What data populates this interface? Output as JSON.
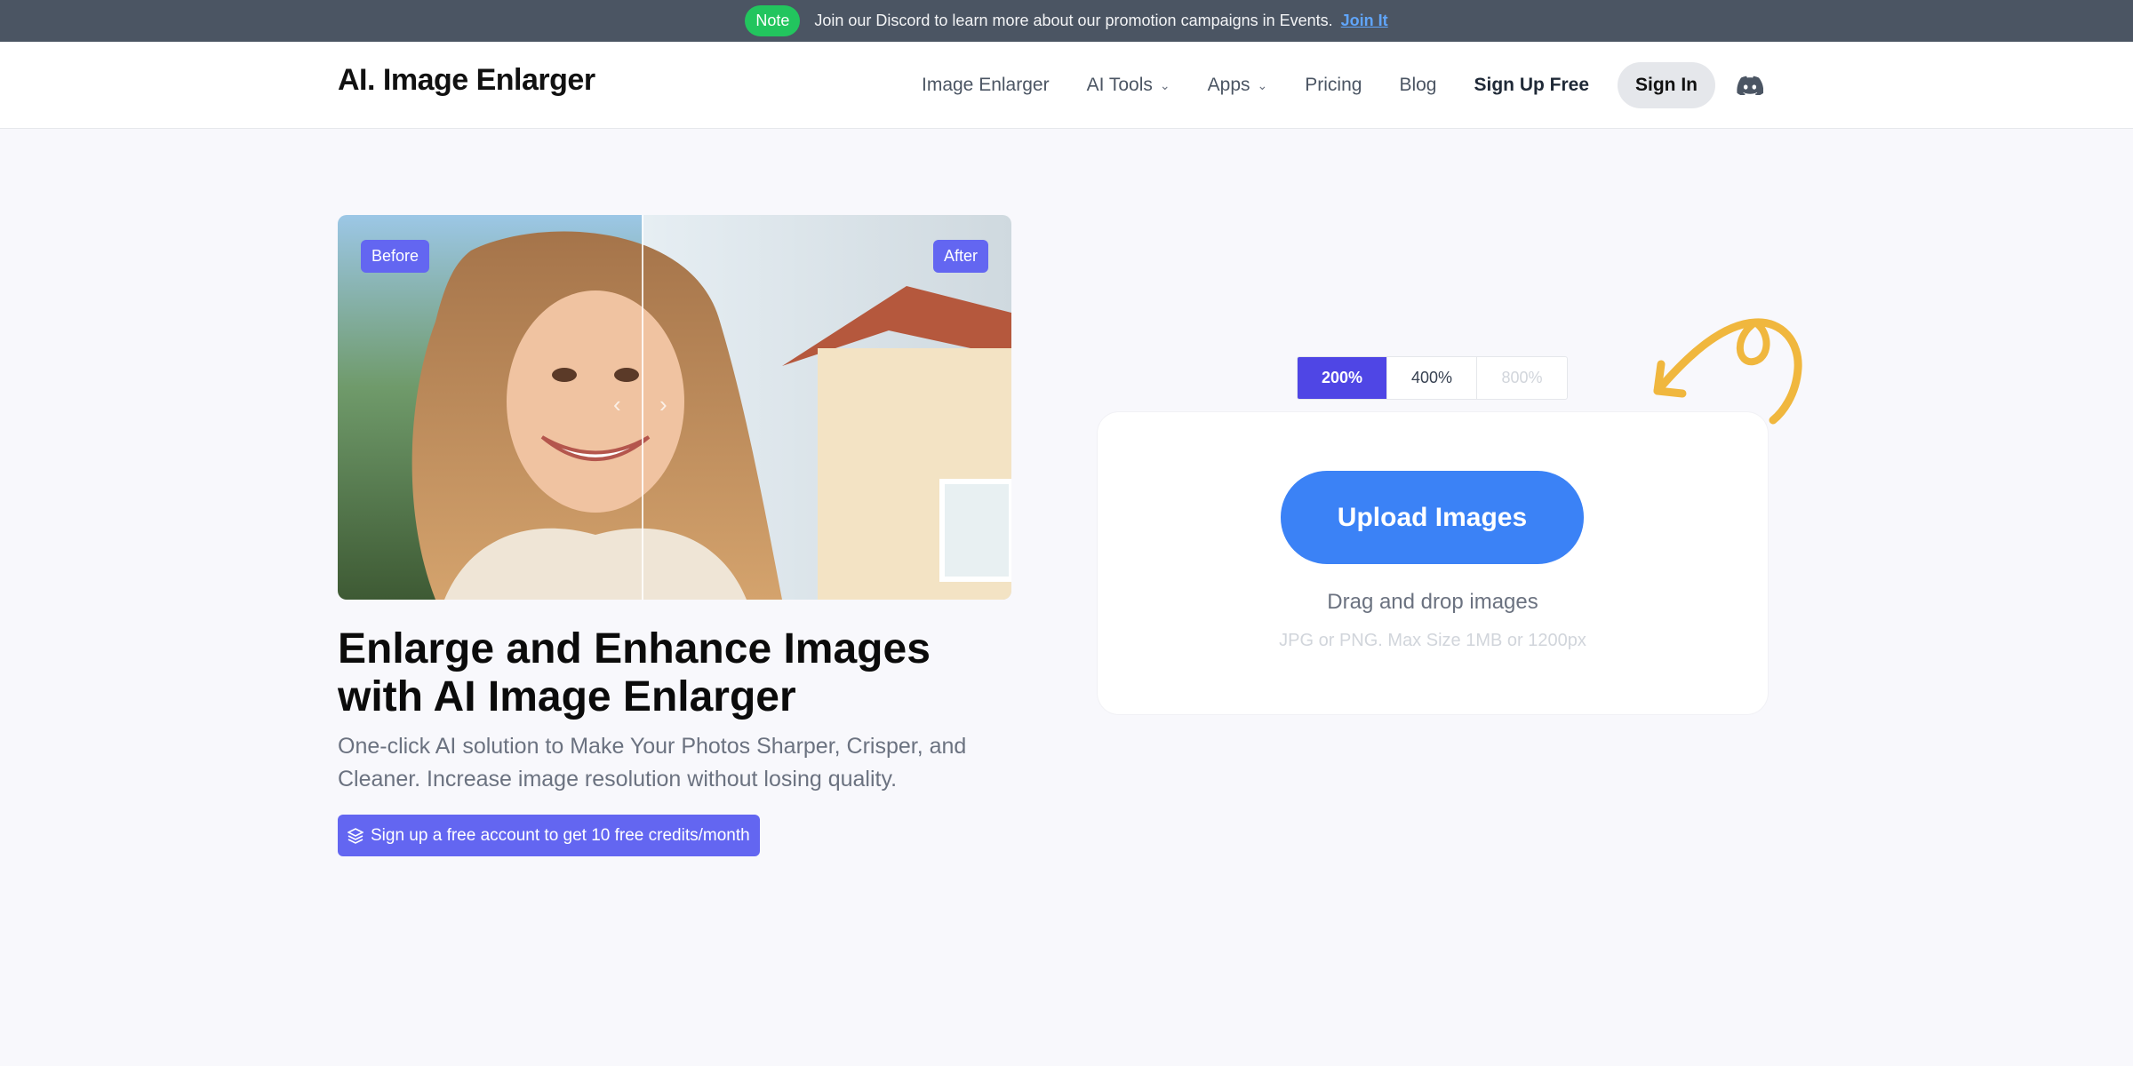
{
  "banner": {
    "badge": "Note",
    "text": "Join our Discord to learn more about our promotion campaigns in Events.",
    "link": "Join It"
  },
  "header": {
    "logo": "AI. Image Enlarger",
    "nav": {
      "image_enlarger": "Image Enlarger",
      "ai_tools": "AI Tools",
      "apps": "Apps",
      "pricing": "Pricing",
      "blog": "Blog",
      "sign_up": "Sign Up Free",
      "sign_in": "Sign In"
    }
  },
  "hero": {
    "compare": {
      "before": "Before",
      "after": "After"
    },
    "headline": "Enlarge and Enhance Images with AI Image Enlarger",
    "subtext": "One-click AI solution to Make Your Photos Sharper, Crisper, and Cleaner. Increase image resolution without losing quality.",
    "credits_button": "Sign up a free account to get 10 free credits/month"
  },
  "upload": {
    "scales": [
      "200%",
      "400%",
      "800%"
    ],
    "selected_scale": "200%",
    "button": "Upload Images",
    "drag": "Drag and drop images",
    "hint": "JPG or PNG. Max Size 1MB or 1200px"
  },
  "colors": {
    "accent": "#6366f1",
    "upload_button": "#3b82f6",
    "scale_active": "#4f46e5",
    "note_badge": "#22c55e",
    "arrow": "#f0b73e"
  }
}
